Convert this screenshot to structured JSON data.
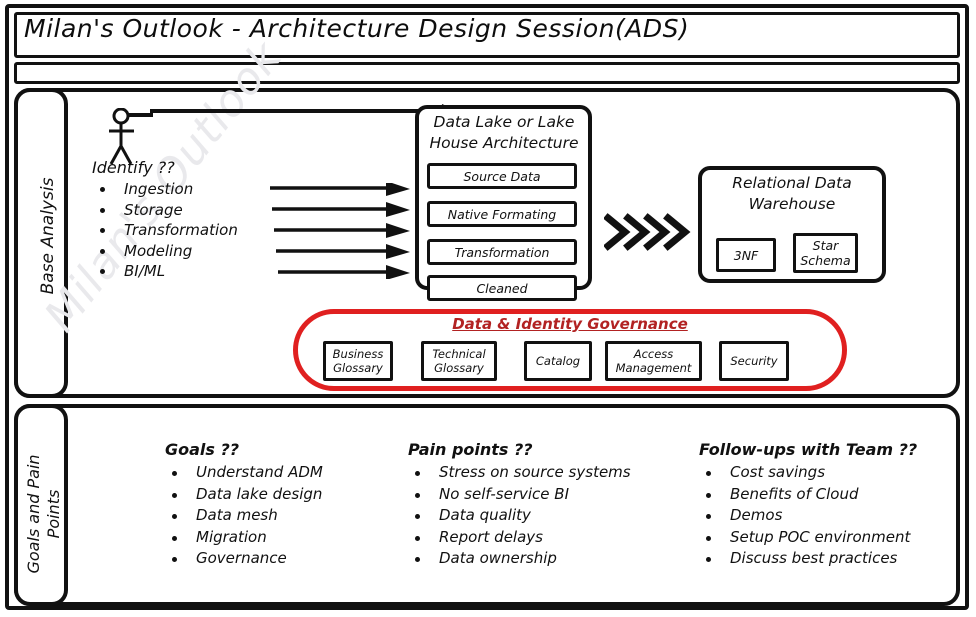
{
  "title": "Milan's Outlook - Architecture Design Session(ADS)",
  "watermark": "Milan's Outlook",
  "sidebars": {
    "base": "Base Analysis",
    "goals_line1": "Goals and Pain",
    "goals_line2": "Points"
  },
  "identify": {
    "heading": "Identify ??",
    "items": [
      "Ingestion",
      "Storage",
      "Transformation",
      "Modeling",
      "BI/ML"
    ]
  },
  "datalake": {
    "title_line1": "Data Lake or Lake",
    "title_line2": "House Architecture",
    "stages": [
      "Source Data",
      "Native Formating",
      "Transformation",
      "Cleaned"
    ]
  },
  "warehouse": {
    "title_line1": "Relational Data",
    "title_line2": "Warehouse",
    "items": [
      "3NF",
      "Star Schema"
    ]
  },
  "governance": {
    "title": "Data & Identity Governance",
    "title_color": "#b22222",
    "oval_color": "#e02020",
    "items": [
      "Business Glossary",
      "Technical Glossary",
      "Catalog",
      "Access Management",
      "Security"
    ]
  },
  "bottom_columns": [
    {
      "heading": "Goals ??",
      "items": [
        "Understand ADM",
        "Data lake design",
        "Data mesh",
        "Migration",
        "Governance"
      ]
    },
    {
      "heading": "Pain points ??",
      "items": [
        "Stress on source systems",
        "No self-service BI",
        "Data quality",
        "Report delays",
        "Data ownership"
      ]
    },
    {
      "heading": "Follow-ups with Team ??",
      "items": [
        "Cost savings",
        "Benefits of Cloud",
        "Demos",
        "Setup POC environment",
        "Discuss best practices"
      ]
    }
  ],
  "icons": {
    "actor": "stick-figure-icon",
    "flow_arrows": "right-arrow-icon",
    "chevrons": "double-chevron-right-icon"
  }
}
